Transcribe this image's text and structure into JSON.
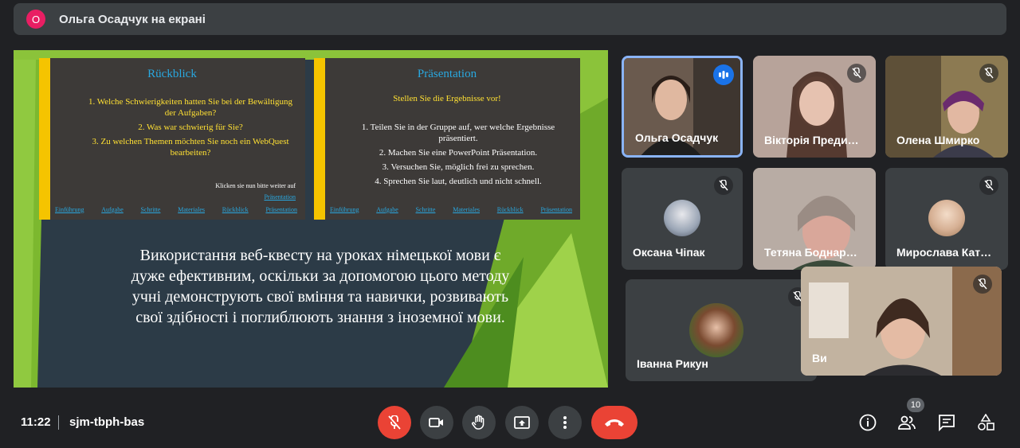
{
  "topbar": {
    "avatar_letter": "О",
    "presenter": "Ольга Осадчук на екрані"
  },
  "slides": {
    "left": {
      "title": "Rückblick",
      "items": [
        "1.  Welche Schwierigkeiten hatten Sie bei der Bewältigung der Aufgaben?",
        "2.  Was war schwierig für Sie?",
        "3.  Zu welchen Themen möchten Sie noch ein WebQuest bearbeiten?"
      ],
      "hint": "Klicken sie nun bitte weiter auf",
      "hint_link": "Präsentation",
      "nav": [
        "Einführung",
        "Aufgabe",
        "Schritte",
        "Materiales",
        "Rückblick",
        "Präsentation"
      ]
    },
    "right": {
      "title": "Präsentation",
      "subtitle": "Stellen Sie die Ergebnisse vor!",
      "items": [
        "1.  Teilen Sie in der Gruppe auf, wer welche Ergebnisse präsentiert.",
        "2.  Machen Sie eine PowerPoint Präsentation.",
        "3.  Versuchen Sie, möglich frei zu sprechen.",
        "4.  Sprechen Sie laut, deutlich und nicht schnell."
      ],
      "nav": [
        "Einführung",
        "Aufgabe",
        "Schritte",
        "Materiales",
        "Rückblick",
        "Präsentation"
      ]
    },
    "caption": "Використання веб-квесту на уроках німецької мови є дуже ефективним, оскільки за допомогою цього методу учні демонструють свої вміння та навички, розвивають свої здібності і поглиблюють знання з іноземної мови."
  },
  "participants": [
    {
      "name": "Ольга Осадчук",
      "speaking": true
    },
    {
      "name": "Вікторія Преди…",
      "muted": true
    },
    {
      "name": "Олена Шмирко",
      "muted": true
    },
    {
      "name": "Оксана Чіпак",
      "muted": true
    },
    {
      "name": "Тетяна Боднар…",
      "muted": true
    },
    {
      "name": "Мирослава Кат…",
      "muted": true
    },
    {
      "name": "Іванна Рикун",
      "muted": true
    },
    {
      "name": "Ви",
      "muted": true
    }
  ],
  "bottombar": {
    "time": "11:22",
    "meeting_code": "sjm-tbph-bas",
    "participants_count": "10"
  },
  "colors": {
    "accent": "#8ab4f8",
    "danger": "#ea4335",
    "speaking": "#1a73e8",
    "presenter": "#e91e63"
  }
}
